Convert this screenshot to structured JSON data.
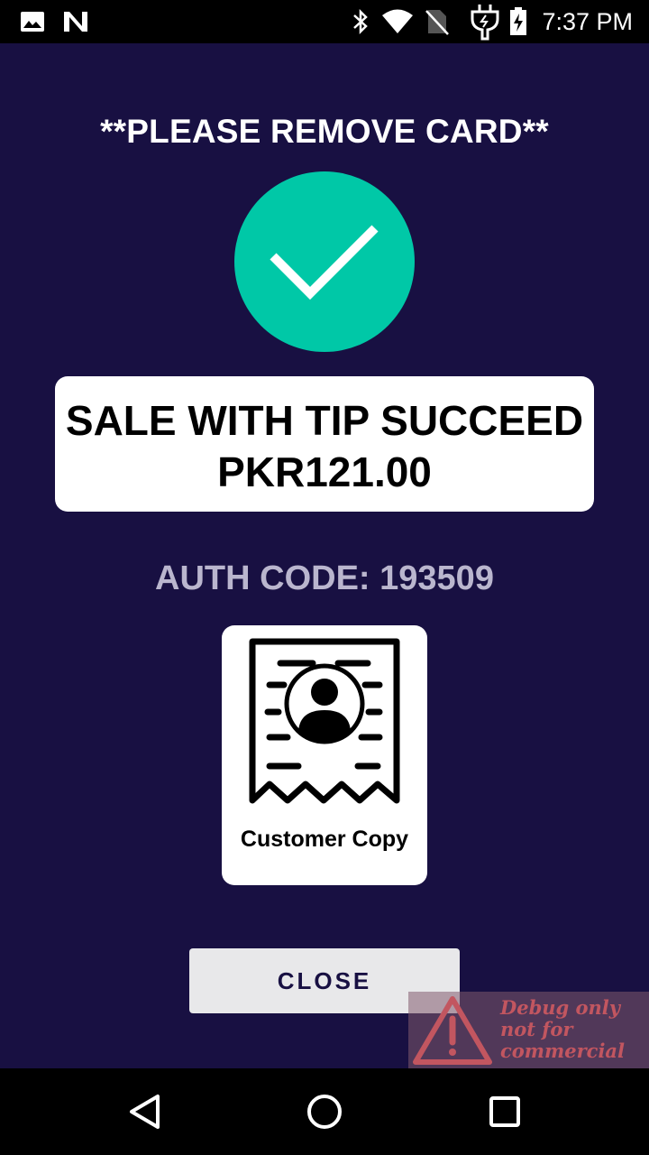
{
  "status_bar": {
    "time": "7:37 PM",
    "icons": [
      "image-notification-icon",
      "n-notification-icon",
      "bluetooth-icon",
      "wifi-icon",
      "no-sim-icon",
      "charging-plug-icon",
      "battery-charging-icon"
    ]
  },
  "main": {
    "instruction": "**PLEASE REMOVE CARD**",
    "status_icon": "checkmark-icon",
    "status_color": "#00c8a7",
    "result_line1": "SALE WITH TIP SUCCEED",
    "result_line2": "PKR121.00",
    "auth_code": "AUTH CODE: 193509",
    "customer_copy_icon": "receipt-person-icon",
    "customer_copy_label": "Customer Copy",
    "close_label": "CLOSE"
  },
  "watermark": {
    "line1": "Debug only",
    "line2": "not for",
    "line3": "commercial"
  },
  "nav_bar": {
    "icons": [
      "back-icon",
      "home-icon",
      "recents-icon"
    ]
  },
  "colors": {
    "background": "#181042",
    "accent_success": "#00c8a7",
    "auth_code_text": "#bab6ce",
    "button_bg": "#e8e8ea"
  }
}
